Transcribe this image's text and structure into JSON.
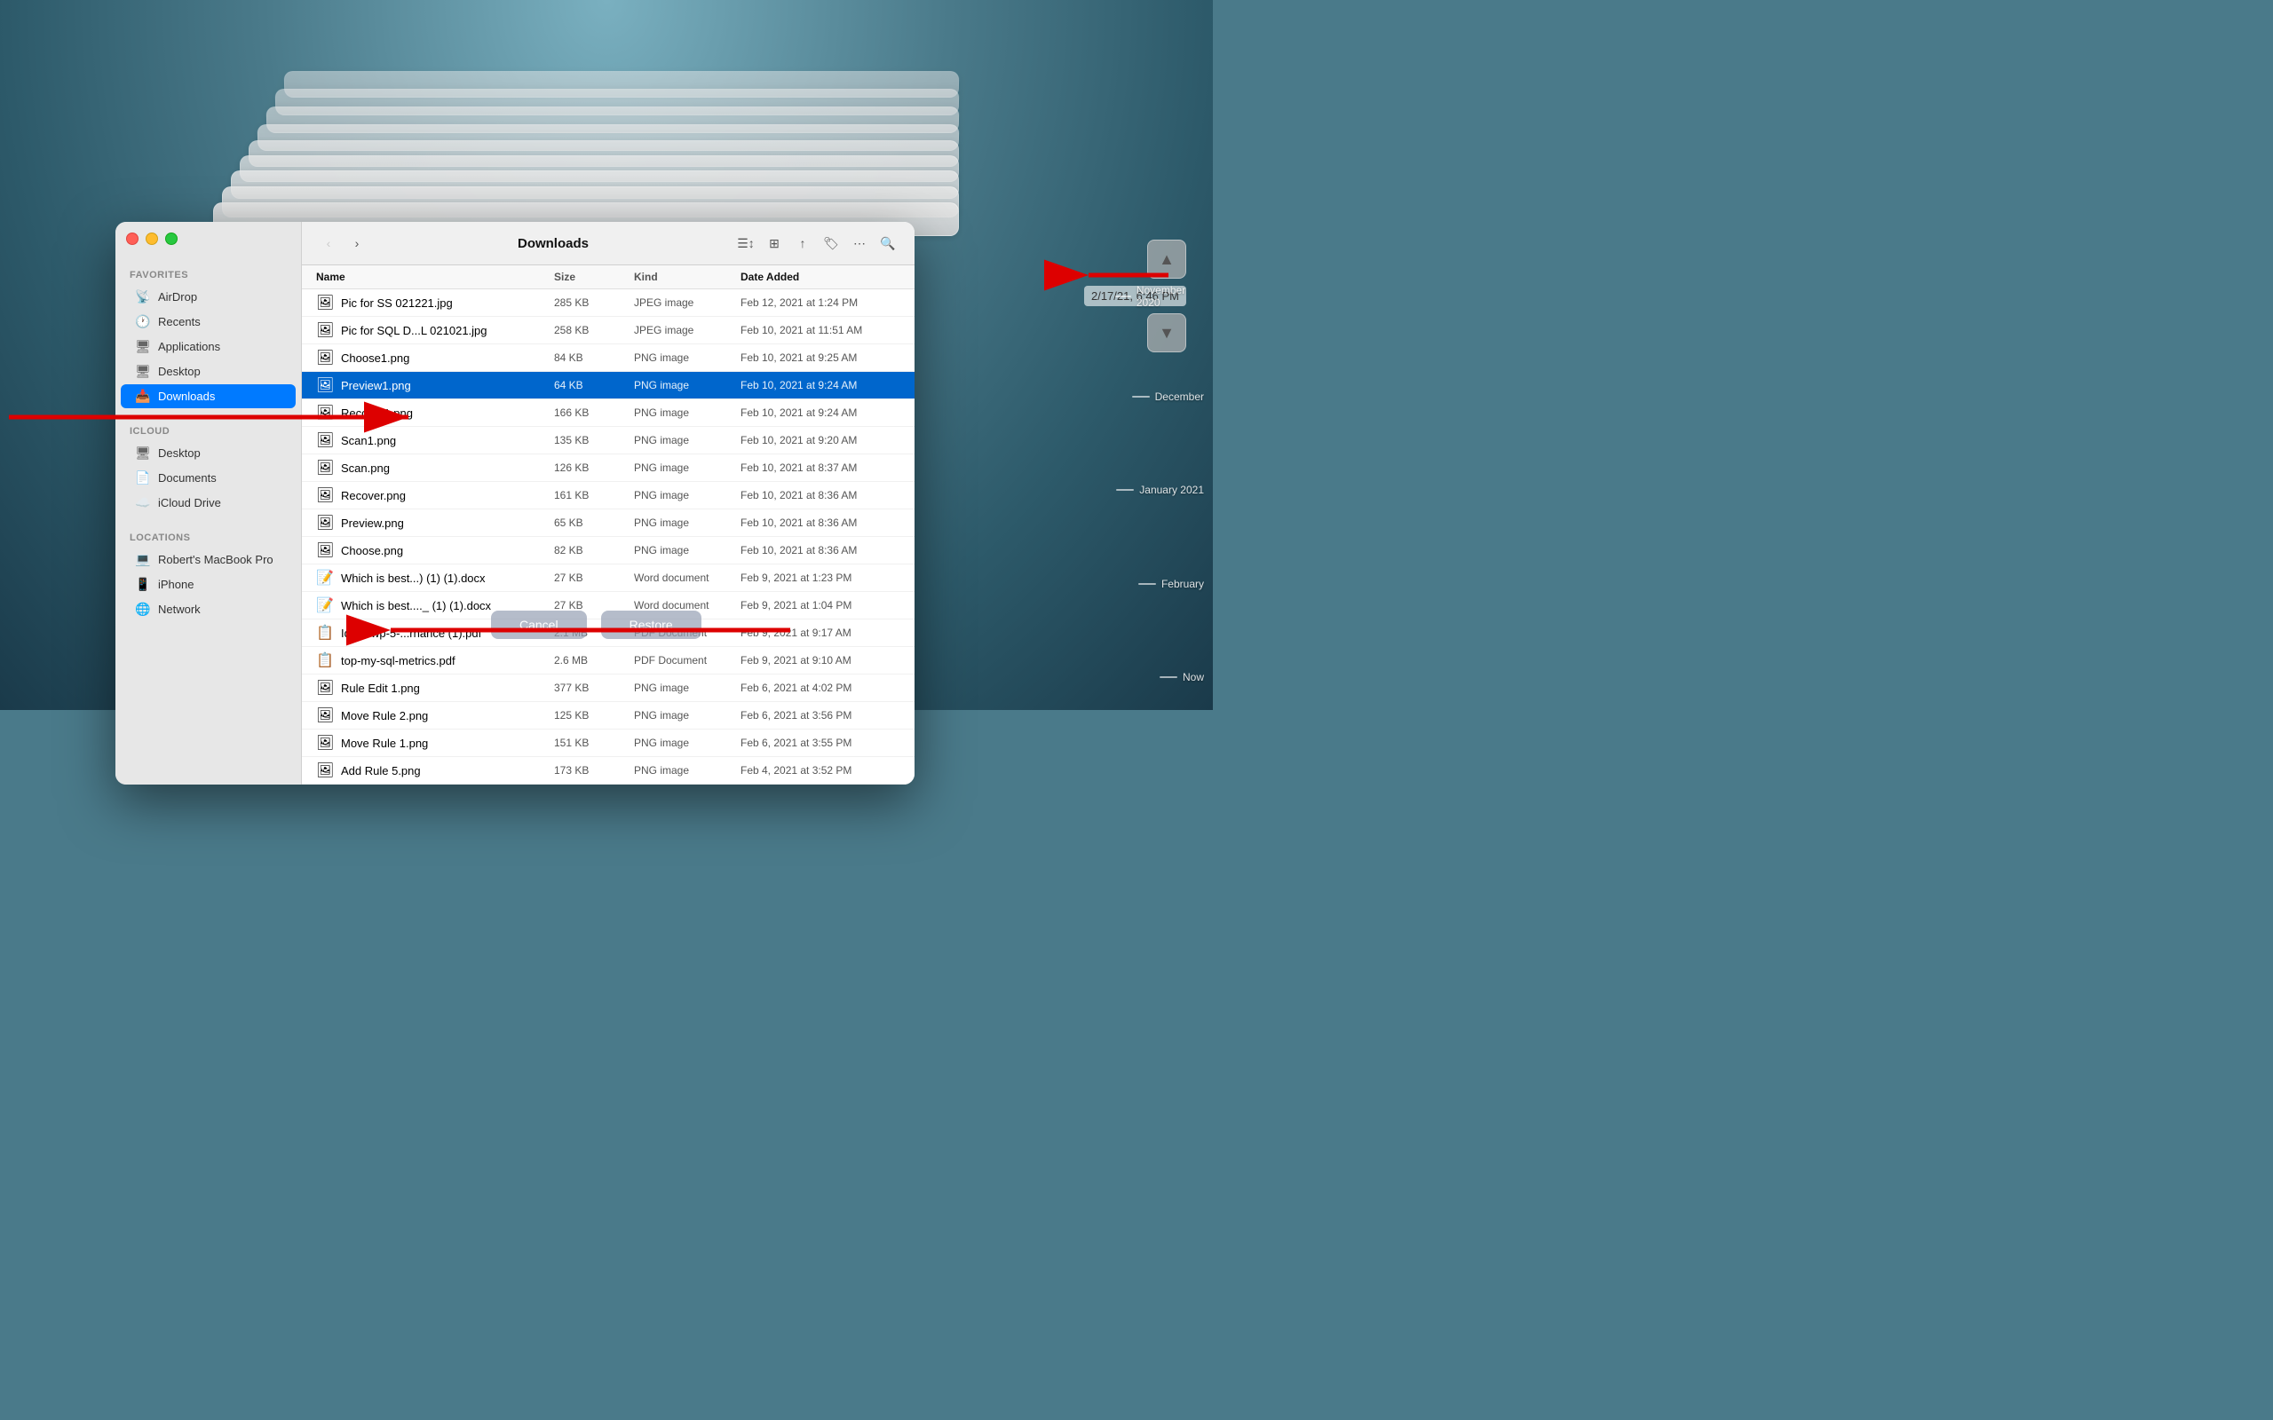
{
  "window": {
    "title": "Downloads",
    "controls": {
      "close": "close",
      "minimize": "minimize",
      "maximize": "maximize"
    }
  },
  "sidebar": {
    "favorites_label": "Favorites",
    "icloud_label": "iCloud",
    "locations_label": "Locations",
    "items": [
      {
        "id": "airdrop",
        "label": "AirDrop",
        "icon": "📡"
      },
      {
        "id": "recents",
        "label": "Recents",
        "icon": "🕐"
      },
      {
        "id": "applications",
        "label": "Applications",
        "icon": "🖥"
      },
      {
        "id": "desktop",
        "label": "Desktop",
        "icon": "🖥"
      },
      {
        "id": "downloads",
        "label": "Downloads",
        "icon": "📥",
        "active": true
      }
    ],
    "icloud_items": [
      {
        "id": "icloud-desktop",
        "label": "Desktop",
        "icon": "🖥"
      },
      {
        "id": "documents",
        "label": "Documents",
        "icon": "📄"
      },
      {
        "id": "icloud-drive",
        "label": "iCloud Drive",
        "icon": "☁️"
      }
    ],
    "location_items": [
      {
        "id": "macbook",
        "label": "Robert's MacBook Pro",
        "icon": "💻"
      },
      {
        "id": "iphone",
        "label": "iPhone",
        "icon": "📱"
      },
      {
        "id": "network",
        "label": "Network",
        "icon": "🌐"
      }
    ]
  },
  "toolbar": {
    "back_label": "‹",
    "forward_label": "›",
    "title": "Downloads",
    "list_view": "☰",
    "grid_view": "⊞",
    "share": "↑",
    "tag": "🏷",
    "more": "•••",
    "search": "🔍"
  },
  "columns": {
    "name": "Name",
    "size": "Size",
    "kind": "Kind",
    "date_added": "Date Added"
  },
  "files": [
    {
      "name": "Pic for SS 021221.jpg",
      "size": "285 KB",
      "kind": "JPEG image",
      "date": "Feb 12, 2021 at 1:24 PM",
      "icon": "🖼",
      "selected": false
    },
    {
      "name": "Pic for SQL D...L 021021.jpg",
      "size": "258 KB",
      "kind": "JPEG image",
      "date": "Feb 10, 2021 at 11:51 AM",
      "icon": "🖼",
      "selected": false
    },
    {
      "name": "Choose1.png",
      "size": "84 KB",
      "kind": "PNG image",
      "date": "Feb 10, 2021 at 9:25 AM",
      "icon": "🖼",
      "selected": false
    },
    {
      "name": "Preview1.png",
      "size": "64 KB",
      "kind": "PNG image",
      "date": "Feb 10, 2021 at 9:24 AM",
      "icon": "🖼",
      "selected": true
    },
    {
      "name": "Recover1.png",
      "size": "166 KB",
      "kind": "PNG image",
      "date": "Feb 10, 2021 at 9:24 AM",
      "icon": "🖼",
      "selected": false
    },
    {
      "name": "Scan1.png",
      "size": "135 KB",
      "kind": "PNG image",
      "date": "Feb 10, 2021 at 9:20 AM",
      "icon": "🖼",
      "selected": false
    },
    {
      "name": "Scan.png",
      "size": "126 KB",
      "kind": "PNG image",
      "date": "Feb 10, 2021 at 8:37 AM",
      "icon": "🖼",
      "selected": false
    },
    {
      "name": "Recover.png",
      "size": "161 KB",
      "kind": "PNG image",
      "date": "Feb 10, 2021 at 8:36 AM",
      "icon": "🖼",
      "selected": false
    },
    {
      "name": "Preview.png",
      "size": "65 KB",
      "kind": "PNG image",
      "date": "Feb 10, 2021 at 8:36 AM",
      "icon": "🖼",
      "selected": false
    },
    {
      "name": "Choose.png",
      "size": "82 KB",
      "kind": "PNG image",
      "date": "Feb 10, 2021 at 8:36 AM",
      "icon": "🖼",
      "selected": false
    },
    {
      "name": "Which is best...) (1) (1).docx",
      "size": "27 KB",
      "kind": "Word document",
      "date": "Feb 9, 2021 at 1:23 PM",
      "icon": "📝",
      "selected": false
    },
    {
      "name": "Which is best...._ (1) (1).docx",
      "size": "27 KB",
      "kind": "Word document",
      "date": "Feb 9, 2021 at 1:04 PM",
      "icon": "📝",
      "selected": false
    },
    {
      "name": "Idera-wp-5-...rnance (1).pdf",
      "size": "2.1 MB",
      "kind": "PDF Document",
      "date": "Feb 9, 2021 at 9:17 AM",
      "icon": "📋",
      "selected": false
    },
    {
      "name": "top-my-sql-metrics.pdf",
      "size": "2.6 MB",
      "kind": "PDF Document",
      "date": "Feb 9, 2021 at 9:10 AM",
      "icon": "📋",
      "selected": false
    },
    {
      "name": "Rule Edit 1.png",
      "size": "377 KB",
      "kind": "PNG image",
      "date": "Feb 6, 2021 at 4:02 PM",
      "icon": "🖼",
      "selected": false
    },
    {
      "name": "Move Rule 2.png",
      "size": "125 KB",
      "kind": "PNG image",
      "date": "Feb 6, 2021 at 3:56 PM",
      "icon": "🖼",
      "selected": false
    },
    {
      "name": "Move Rule 1.png",
      "size": "151 KB",
      "kind": "PNG image",
      "date": "Feb 6, 2021 at 3:55 PM",
      "icon": "🖼",
      "selected": false
    },
    {
      "name": "Add Rule 5.png",
      "size": "173 KB",
      "kind": "PNG image",
      "date": "Feb 4, 2021 at 3:52 PM",
      "icon": "🖼",
      "selected": false
    }
  ],
  "timemachine": {
    "timestamp": "2/17/21, 6:46 PM",
    "timeline_labels": [
      "November 2020",
      "December",
      "January 2021",
      "February",
      "Now"
    ]
  },
  "buttons": {
    "cancel": "Cancel",
    "restore": "Restore"
  }
}
